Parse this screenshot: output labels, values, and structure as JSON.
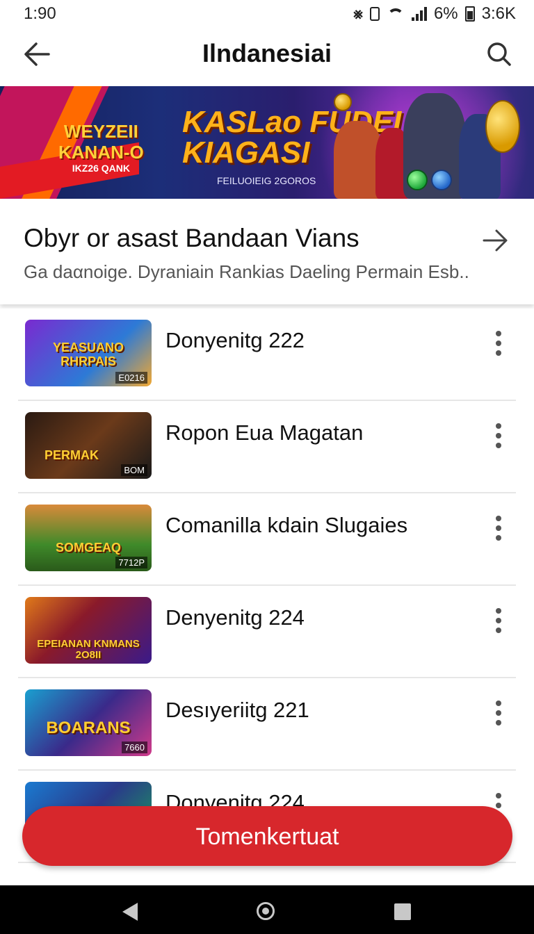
{
  "status_bar": {
    "time": "1:90",
    "battery_text": "6%",
    "network_text": "3:6K",
    "icons": [
      "nfc-icon",
      "alarm-icon",
      "wifi-icon",
      "signal-icon",
      "battery-icon"
    ]
  },
  "app_bar": {
    "title": "Ilndanesiai",
    "back_icon": "arrow-left-icon",
    "search_icon": "search-icon"
  },
  "banner": {
    "logo_line1": "WEYZEII",
    "logo_line2": "KANAN-O",
    "logo_sub": "IKZ26 QANK",
    "headline_line1": "KASLao FUDEI",
    "headline_line2": "KIAGASI",
    "subtext": "FEILUOIEIG 2GOROS"
  },
  "section": {
    "title": "Obyr or asast Bandaan Vians",
    "subtitle": "Ga daαnoige. Dyraniain Rankias Daeling Permain Esb..",
    "arrow_icon": "arrow-right-icon"
  },
  "list": {
    "items": [
      {
        "title": "Donyenitg 222",
        "thumb_text": "YEASUANO RHRPAIS",
        "thumb_badge": "E0216"
      },
      {
        "title": "Ropon Eua Magatan",
        "thumb_text": "PERMAK",
        "thumb_badge": "BOM"
      },
      {
        "title": "Comanilla kdain Slugaies",
        "thumb_text": "SOMGEAQ",
        "thumb_badge": "7712P"
      },
      {
        "title": "Denyenitg 224",
        "thumb_text": "EPEIANAN KNMANS 2O8II",
        "thumb_badge": ""
      },
      {
        "title": "Desıyeriitg 221",
        "thumb_text": "BOARANS",
        "thumb_badge": "7660"
      },
      {
        "title": "Donyenitg 224",
        "thumb_text": "",
        "thumb_badge": ""
      }
    ],
    "more_icon": "more-vertical-icon"
  },
  "cta": {
    "label": "Tomenkertuat"
  },
  "nav_bar": {
    "icons": [
      "nav-back-icon",
      "nav-home-icon",
      "nav-recents-icon"
    ]
  },
  "colors": {
    "accent": "#d7272c",
    "divider": "#e6e6e6",
    "nav_bg": "#000000"
  }
}
